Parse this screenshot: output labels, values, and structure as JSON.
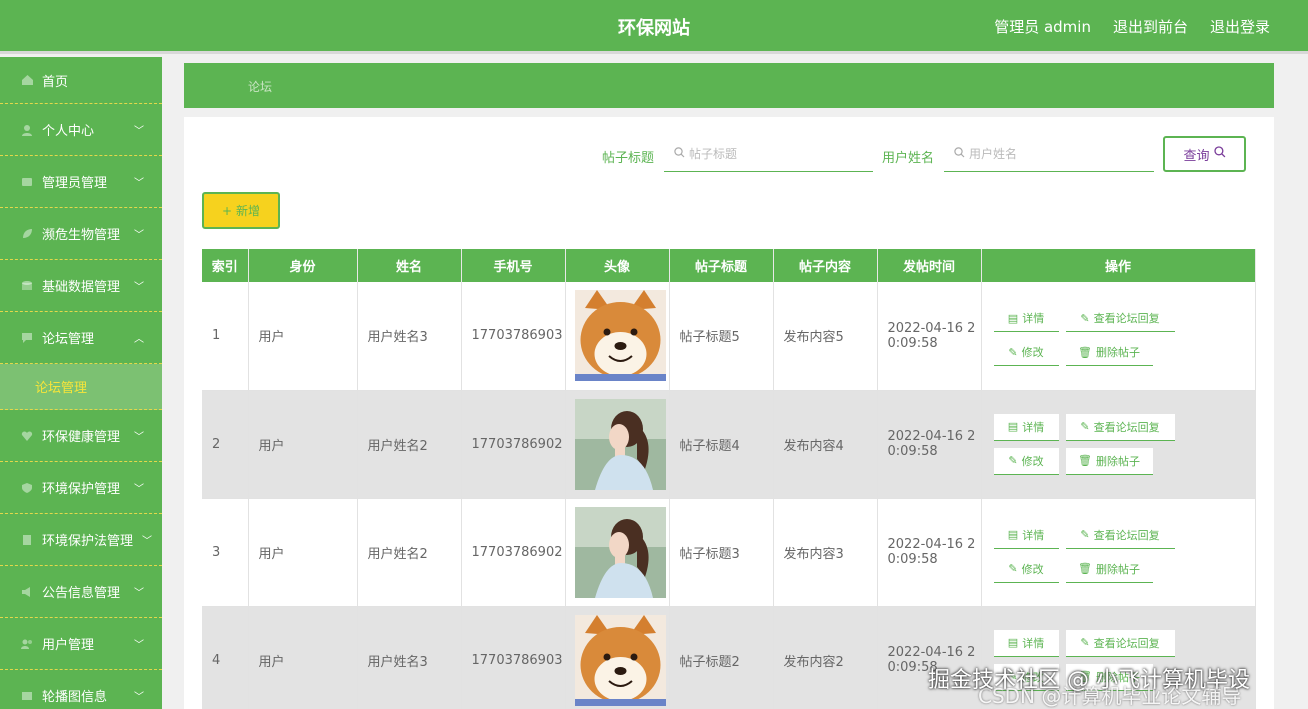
{
  "header": {
    "title": "环保网站",
    "admin_label": "管理员 admin",
    "front_link": "退出到前台",
    "logout_link": "退出登录"
  },
  "sidebar": {
    "items": [
      {
        "label": "首页",
        "icon": "home-icon"
      },
      {
        "label": "个人中心",
        "icon": "user-icon"
      },
      {
        "label": "管理员管理",
        "icon": "admin-icon"
      },
      {
        "label": "濒危生物管理",
        "icon": "leaf-icon"
      },
      {
        "label": "基础数据管理",
        "icon": "database-icon"
      },
      {
        "label": "论坛管理",
        "icon": "forum-icon",
        "expanded": true
      },
      {
        "label": "环保健康管理",
        "icon": "health-icon"
      },
      {
        "label": "环境保护管理",
        "icon": "shield-icon"
      },
      {
        "label": "环境保护法管理",
        "icon": "law-icon"
      },
      {
        "label": "公告信息管理",
        "icon": "notice-icon"
      },
      {
        "label": "用户管理",
        "icon": "users-icon"
      },
      {
        "label": "轮播图信息",
        "icon": "image-icon"
      }
    ],
    "submenu_label": "论坛管理"
  },
  "breadcrumb": {
    "label": "论坛"
  },
  "search": {
    "title_label": "帖子标题",
    "title_placeholder": "帖子标题",
    "user_label": "用户姓名",
    "user_placeholder": "用户姓名",
    "query_button": "查询"
  },
  "add_button": "新增",
  "table": {
    "columns": [
      "索引",
      "身份",
      "姓名",
      "手机号",
      "头像",
      "帖子标题",
      "帖子内容",
      "发帖时间",
      "操作"
    ],
    "rows": [
      {
        "index": "1",
        "role": "用户",
        "name": "用户姓名3",
        "phone": "17703786903",
        "avatar": "shiba",
        "title": "帖子标题5",
        "content": "发布内容5",
        "time_a": "2022-04-16 2",
        "time_b": "0:09:58"
      },
      {
        "index": "2",
        "role": "用户",
        "name": "用户姓名2",
        "phone": "17703786902",
        "avatar": "girl",
        "title": "帖子标题4",
        "content": "发布内容4",
        "time_a": "2022-04-16 2",
        "time_b": "0:09:58"
      },
      {
        "index": "3",
        "role": "用户",
        "name": "用户姓名2",
        "phone": "17703786902",
        "avatar": "girl",
        "title": "帖子标题3",
        "content": "发布内容3",
        "time_a": "2022-04-16 2",
        "time_b": "0:09:58"
      },
      {
        "index": "4",
        "role": "用户",
        "name": "用户姓名3",
        "phone": "17703786903",
        "avatar": "shiba",
        "title": "帖子标题2",
        "content": "发布内容2",
        "time_a": "2022-04-16 2",
        "time_b": "0:09:58"
      }
    ],
    "actions": {
      "detail": "详情",
      "view_replies": "查看论坛回复",
      "edit": "修改",
      "delete": "删除帖子"
    }
  },
  "watermark": {
    "line1": "掘金技术社区 @ 小飞计算机毕设",
    "line2": "CSDN @计算机毕业论文辅导"
  },
  "colors": {
    "primary": "#5cb452",
    "accent_yellow": "#f6d21e",
    "submenu_active": "#7cc172",
    "row_alt": "#e3e3e3"
  }
}
